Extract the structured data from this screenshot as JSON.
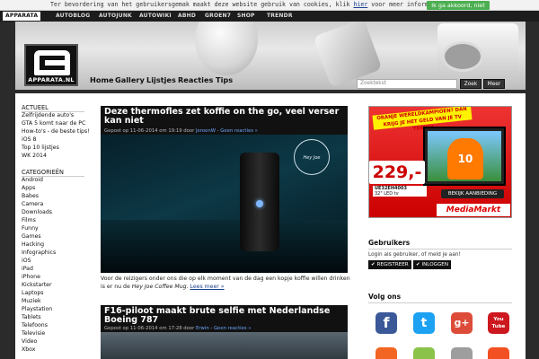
{
  "cookie_bar": {
    "text_before": "Ter bevordering van het gebruikersgemak maakt deze website gebruik van cookies, klik ",
    "link": "hier",
    "text_after": " voor meer informatie.",
    "accept_label": "Ik ga akkoord, niet meer"
  },
  "topnav": {
    "items": [
      "APPARATA",
      "AUTOBLOG",
      "AUTOJUNK",
      "AUTOWIKI",
      "ABHD",
      "GROEN7",
      "SHOP",
      "TRENDR"
    ]
  },
  "logo": {
    "text": "APPARATA.NL"
  },
  "mainnav": {
    "items": [
      "Home",
      "Gallery",
      "Lijstjes",
      "Reacties",
      "Tips"
    ]
  },
  "search": {
    "placeholder": "Zoektekst",
    "button": "Zoek",
    "more": "Meer"
  },
  "sidebar": {
    "actueel_heading": "ACTUEEL",
    "actueel": [
      "Zelfrijdende auto's",
      "GTA 5 komt naar de PC",
      "How-to's - de beste tips!",
      "iOS 8",
      "Top 10 lijstjes",
      "WK 2014"
    ],
    "categorieen_heading": "CATEGORIEËN",
    "categorieen": [
      "Android",
      "Apps",
      "Babes",
      "Camera",
      "Downloads",
      "Films",
      "Funny",
      "Games",
      "Hacking",
      "Infographics",
      "iOS",
      "iPad",
      "iPhone",
      "Kickstarter",
      "Laptops",
      "Muziek",
      "Playstation",
      "Tablets",
      "Telefoons",
      "Televisie",
      "Video",
      "Xbox"
    ]
  },
  "articles": [
    {
      "title": "Deze thermofles zet koffie on the go, veel verser kan niet",
      "meta_prefix": "Gepost op 11-06-2014 om 19:19 door ",
      "author": "JeroenW",
      "meta_sep": " - ",
      "comments": "Geen reacties »",
      "excerpt_before": "Voor de reizigers onder ons die op elk moment van de dag een kopje koffie willen drinken is er nu de ",
      "excerpt_italic": "Hey Joe Coffee Mug",
      "excerpt_after": ". ",
      "read_more": "Lees meer »",
      "image_label": "Hey Joe"
    },
    {
      "title": "F16-piloot maakt brute selfie met Nederlandse Boeing 787",
      "meta_prefix": "Gepost op 11-06-2014 om 17:28 door ",
      "author": "Erwin",
      "meta_sep": " - ",
      "comments": "Geen reacties »"
    }
  ],
  "ad": {
    "banner": "ORANJE WERELDKAMPIOEN? DAN KRIJG JE HET GELD VAN JE TV TERUG!",
    "price": "229,-",
    "model": "UE32EH4003",
    "model_sub": "32\" LED tv",
    "shirt_number": "10",
    "cta": "BEKIJK AANBIEDING",
    "brand": "MediaMarkt"
  },
  "users": {
    "heading": "Gebruikers",
    "text": "Login als gebruiker, of meld je aan!",
    "register": "REGISTREER",
    "login": "INLOGGEN"
  },
  "follow": {
    "heading": "Volg ons",
    "icons": [
      {
        "name": "facebook-icon",
        "glyph": "f",
        "color": "#3b5998"
      },
      {
        "name": "twitter-icon",
        "glyph": "t",
        "color": "#1da1f2"
      },
      {
        "name": "google-plus-icon",
        "glyph": "g+",
        "color": "#dd4b39"
      },
      {
        "name": "youtube-icon",
        "glyph": "You Tube",
        "color": "#cc181e"
      },
      {
        "name": "rss-icon",
        "glyph": "",
        "color": "#f26522"
      },
      {
        "name": "android-icon",
        "glyph": "",
        "color": "#8bc34a"
      },
      {
        "name": "apple-icon",
        "glyph": "",
        "color": "#9e9e9e"
      },
      {
        "name": "windows-icon",
        "glyph": "",
        "color": "#f25022"
      }
    ]
  }
}
